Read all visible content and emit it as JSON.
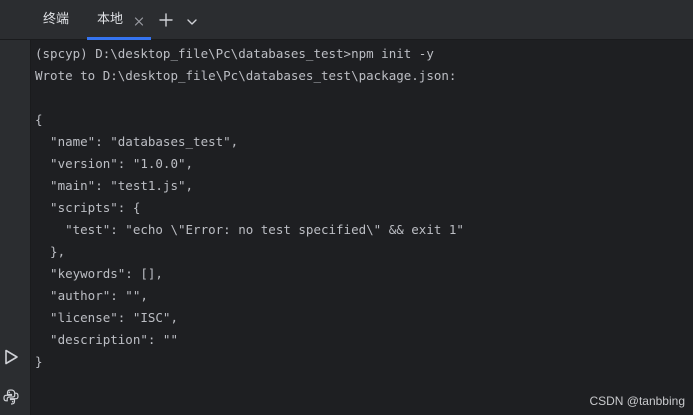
{
  "tabs": {
    "title": "终端",
    "local": "本地"
  },
  "icons": {
    "close": "close-icon",
    "add": "plus-icon",
    "menu": "chevron-down-icon",
    "run": "run-icon",
    "python": "python-console-icon"
  },
  "colors": {
    "background": "#1e1f22",
    "panel": "#2b2d30",
    "text": "#bcbec4",
    "accent": "#3574f0"
  },
  "terminal": {
    "lines": [
      "(spcyp) D:\\desktop_file\\Pc\\databases_test>npm init -y",
      "Wrote to D:\\desktop_file\\Pc\\databases_test\\package.json:",
      "",
      "{",
      "  \"name\": \"databases_test\",",
      "  \"version\": \"1.0.0\",",
      "  \"main\": \"test1.js\",",
      "  \"scripts\": {",
      "    \"test\": \"echo \\\"Error: no test specified\\\" && exit 1\"",
      "  },",
      "  \"keywords\": [],",
      "  \"author\": \"\",",
      "  \"license\": \"ISC\",",
      "  \"description\": \"\"",
      "}"
    ]
  },
  "watermark": "CSDN @tanbbing"
}
